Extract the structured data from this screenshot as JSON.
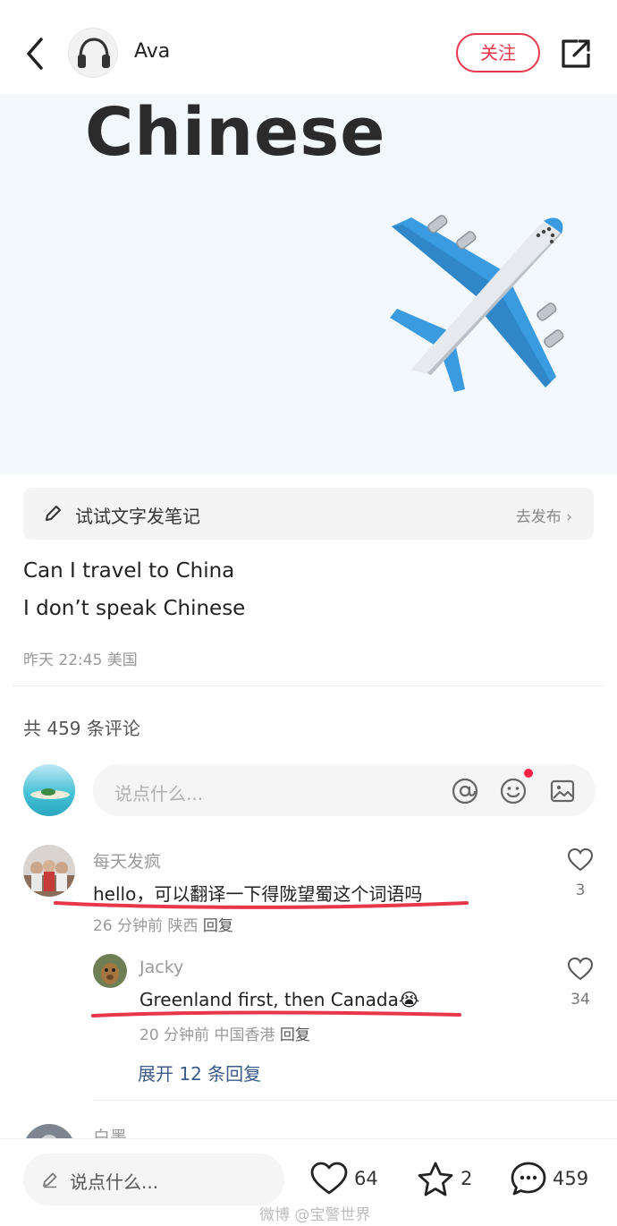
{
  "header": {
    "author_name": "Ava",
    "follow_label": "关注"
  },
  "hero": {
    "title": "Chinese"
  },
  "try_note": {
    "label": "试试文字发笔记",
    "action": "去发布 ›"
  },
  "post": {
    "line1": "Can I travel to China",
    "line2": "I don’t speak Chinese",
    "meta": "昨天 22:45 美国"
  },
  "comments_section": {
    "count_label": "共 459 条评论",
    "input_placeholder": "说点什么..."
  },
  "comments": [
    {
      "name": "每天发疯",
      "text": "hello，可以翻译一下得陇望蜀这个词语吗",
      "meta": "26 分钟前 陕西 ",
      "reply_label": "回复",
      "likes": "3"
    },
    {
      "name": "Jacky",
      "text": "Greenland first, then Canada",
      "emoji": "😭",
      "meta": "20 分钟前 中国香港 ",
      "reply_label": "回复",
      "likes": "34"
    }
  ],
  "expand_label": "展开 12 条回复",
  "partial_comment_name": "白墨",
  "bottom_bar": {
    "input_placeholder": "说点什么...",
    "likes": "64",
    "stars": "2",
    "comments": "459"
  },
  "watermark": "微博 @宝警世界",
  "colors": {
    "accent": "#e8364a",
    "underline": "#e8364a",
    "link_blue": "#3b5a8a"
  },
  "icons": [
    "back-icon",
    "headphones-icon",
    "share-icon",
    "airplane-icon",
    "pencil-icon",
    "at-icon",
    "emoji-icon",
    "image-icon",
    "heart-icon",
    "star-icon",
    "comment-bubble-icon"
  ]
}
